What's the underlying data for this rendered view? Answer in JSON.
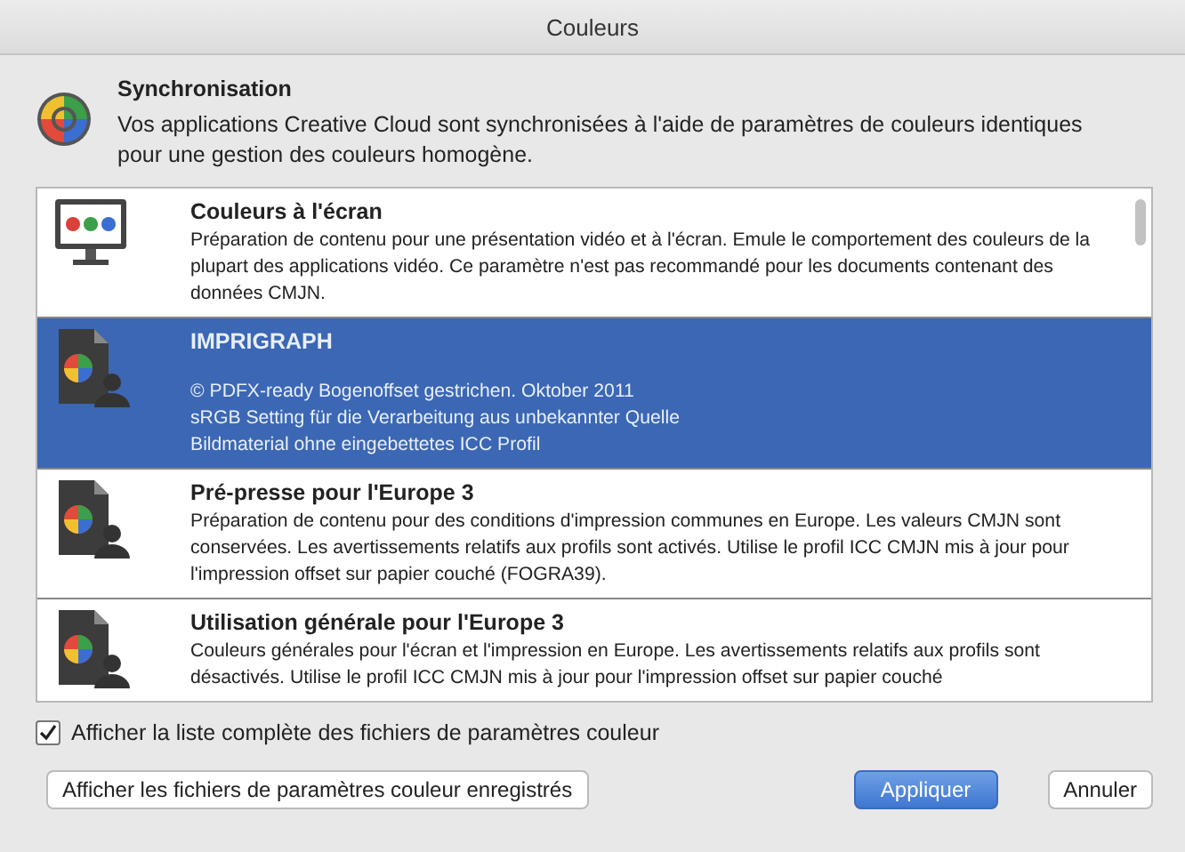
{
  "window": {
    "title": "Couleurs"
  },
  "sync": {
    "title": "Synchronisation",
    "text": "Vos applications Creative Cloud sont synchronisées à l'aide de paramètres de couleurs identiques pour une gestion des couleurs homogène."
  },
  "settings": [
    {
      "kind": "screen",
      "title": "Couleurs à l'écran",
      "lines": [
        "Préparation de contenu pour une présentation vidéo et à l'écran. Emule le comportement des couleurs de la plupart des applications vidéo. Ce paramètre n'est pas recommandé pour les documents contenant des données CMJN."
      ],
      "selected": false
    },
    {
      "kind": "document",
      "title": "IMPRIGRAPH",
      "lines": [
        "© PDFX-ready Bogenoffset gestrichen. Oktober 2011",
        "sRGB Setting für die Verarbeitung aus unbekannter Quelle",
        "Bildmaterial ohne eingebettetes ICC Profil"
      ],
      "selected": true
    },
    {
      "kind": "document",
      "title": "Pré-presse pour l'Europe 3",
      "lines": [
        "Préparation de contenu pour des conditions d'impression communes en Europe. Les valeurs CMJN sont conservées. Les avertissements relatifs aux profils sont activés. Utilise le profil ICC CMJN mis à jour pour l'impression offset sur papier couché (FOGRA39)."
      ],
      "selected": false
    },
    {
      "kind": "document",
      "title": "Utilisation générale pour l'Europe 3",
      "lines": [
        "Couleurs générales pour l'écran et l'impression en Europe. Les avertissements relatifs aux profils sont désactivés. Utilise le profil ICC CMJN mis à jour pour l'impression offset sur papier couché"
      ],
      "selected": false
    }
  ],
  "full_list": {
    "label": "Afficher la liste complète des fichiers de paramètres couleur",
    "checked": true
  },
  "buttons": [
    {
      "kind": "secondary",
      "label": "Afficher les fichiers de paramètres couleur enregistrés"
    },
    {
      "kind": "default",
      "label": "Appliquer"
    },
    {
      "kind": "secondary",
      "label": "Annuler"
    }
  ]
}
